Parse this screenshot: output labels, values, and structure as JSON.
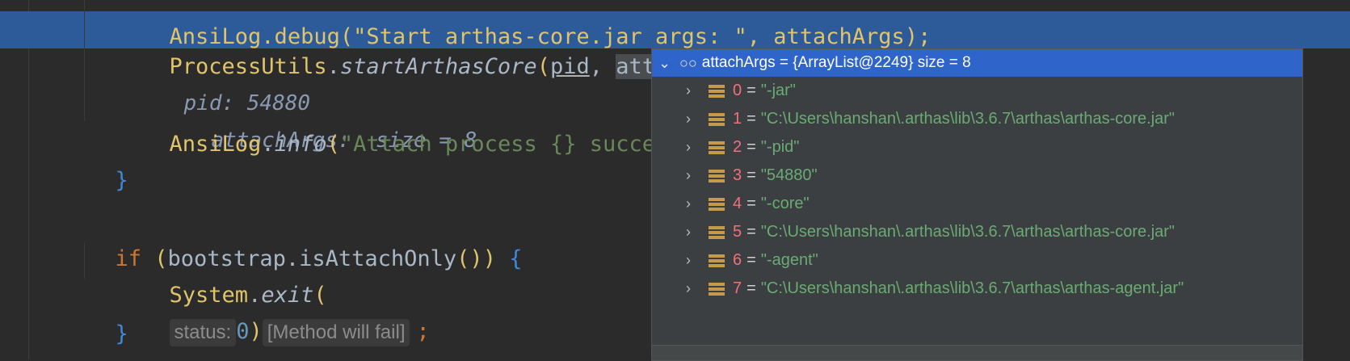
{
  "editor": {
    "line0_partial": "AnsiLog.debug(\"Start arthas-core.jar args: \", attachArgs);",
    "line1": {
      "class": "ProcessUtils",
      "dot": ".",
      "method": "startArthasCore",
      "open": "(",
      "arg1": "pid",
      "comma": ", ",
      "arg2": "attachArgs",
      "close": ");",
      "inline_pid": "pid: 54880",
      "inline_args": "attachArgs:  size = 8"
    },
    "line3": {
      "class": "AnsiLog",
      "dot": ".",
      "method": "info",
      "open": "(",
      "str": "\"Attach process {} succe"
    },
    "line4_brace": "}",
    "line6": {
      "kw": "if",
      "open": " (",
      "expr": "bootstrap.isAttachOnly",
      "call": "()",
      "close": ") ",
      "brace": "{"
    },
    "line7": {
      "class": "System",
      "dot": ".",
      "method": "exit",
      "open": "(",
      "hint_status": "status:",
      "num": "0",
      "close": ")",
      "hint_fail": "[Method will fail]",
      "semi": ";"
    },
    "line8_brace": "}"
  },
  "popup": {
    "header": "attachArgs = {ArrayList@2249}  size = 8",
    "items": [
      {
        "idx": "0",
        "value": "\"-jar\""
      },
      {
        "idx": "1",
        "value": "\"C:\\Users\\hanshan\\.arthas\\lib\\3.6.7\\arthas\\arthas-core.jar\""
      },
      {
        "idx": "2",
        "value": "\"-pid\""
      },
      {
        "idx": "3",
        "value": "\"54880\""
      },
      {
        "idx": "4",
        "value": "\"-core\""
      },
      {
        "idx": "5",
        "value": "\"C:\\Users\\hanshan\\.arthas\\lib\\3.6.7\\arthas\\arthas-core.jar\""
      },
      {
        "idx": "6",
        "value": "\"-agent\""
      },
      {
        "idx": "7",
        "value": "\"C:\\Users\\hanshan\\.arthas\\lib\\3.6.7\\arthas\\arthas-agent.jar\""
      }
    ]
  }
}
